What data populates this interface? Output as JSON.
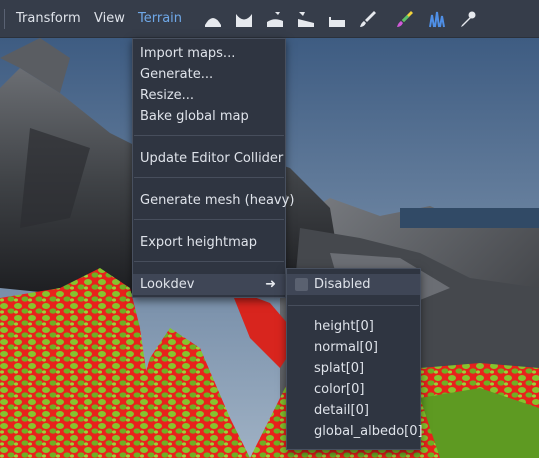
{
  "menubar": {
    "items": [
      {
        "label": "Transform"
      },
      {
        "label": "View"
      },
      {
        "label": "Terrain"
      }
    ],
    "tools": [
      "raise-terrain-icon",
      "lower-terrain-icon",
      "smooth-terrain-icon",
      "level-terrain-icon",
      "flatten-terrain-icon",
      "paint-brush-icon",
      "color-brush-icon",
      "grass-icon",
      "eyedropper-icon"
    ]
  },
  "terrain_menu": {
    "items": [
      {
        "label": "Import maps..."
      },
      {
        "label": "Generate..."
      },
      {
        "label": "Resize..."
      },
      {
        "label": "Bake global map"
      },
      {
        "label": "Update Editor Collider"
      },
      {
        "label": "Generate mesh (heavy)"
      },
      {
        "label": "Export heightmap"
      },
      {
        "label": "Lookdev"
      }
    ]
  },
  "lookdev_menu": {
    "disabled": {
      "label": "Disabled",
      "checked": false
    },
    "items": [
      {
        "label": "height[0]"
      },
      {
        "label": "normal[0]"
      },
      {
        "label": "splat[0]"
      },
      {
        "label": "color[0]"
      },
      {
        "label": "detail[0]"
      },
      {
        "label": "global_albedo[0]"
      }
    ]
  },
  "colors": {
    "menubar_bg": "#363d4a",
    "menu_bg": "#2f3541",
    "active_menu": "#6fa8e8",
    "text": "#dfe3ea",
    "splat_red": "#e8221c",
    "grass_green": "#7fbf2a"
  }
}
